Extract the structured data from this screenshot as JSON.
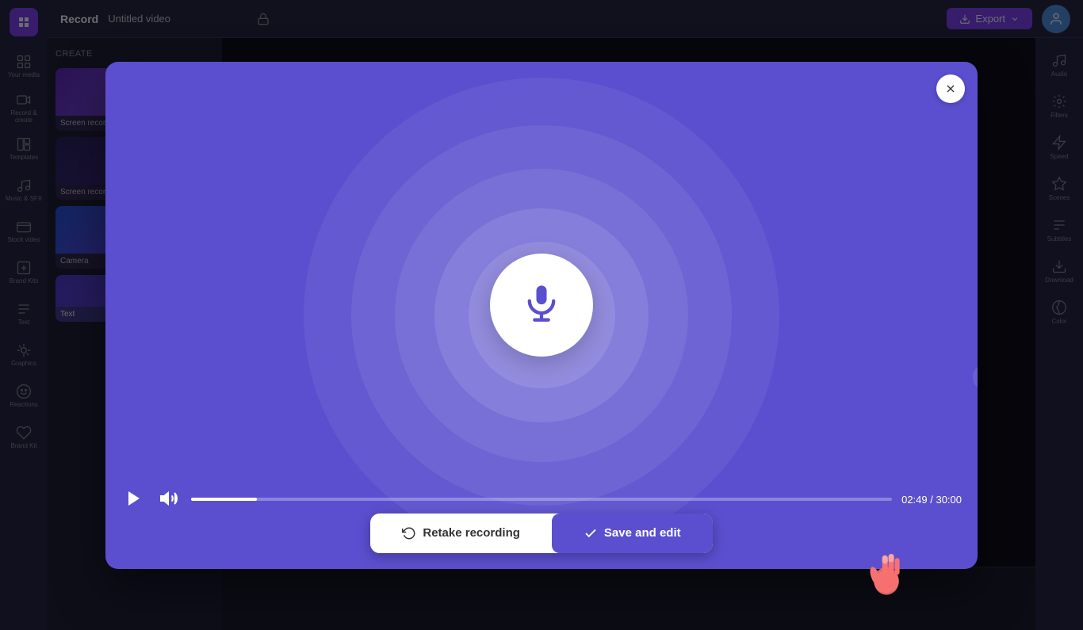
{
  "app": {
    "title": "Record"
  },
  "header": {
    "record_title": "Record",
    "video_title": "Untitled video",
    "export_label": "Export"
  },
  "modal": {
    "close_label": "×",
    "time_current": "02:49",
    "time_total": "30:00",
    "time_display": "02:49 / 30:00"
  },
  "actions": {
    "retake_label": "Retake recording",
    "save_label": "Save and edit"
  },
  "sidebar": {
    "items": [
      {
        "label": "Your media",
        "icon": "grid"
      },
      {
        "label": "Record & create",
        "icon": "video"
      },
      {
        "label": "Templates",
        "icon": "layout"
      },
      {
        "label": "Music & SFX",
        "icon": "music"
      },
      {
        "label": "Stock video",
        "icon": "film"
      },
      {
        "label": "Brand Kits",
        "icon": "bookmark"
      },
      {
        "label": "Text",
        "icon": "type"
      },
      {
        "label": "Graphics",
        "icon": "shapes"
      },
      {
        "label": "Reactions",
        "icon": "smile"
      },
      {
        "label": "Brand Kit",
        "icon": "flag"
      }
    ]
  },
  "right_sidebar": {
    "items": [
      {
        "label": "Audio",
        "icon": "music"
      },
      {
        "label": "Filters",
        "icon": "sliders"
      },
      {
        "label": "Speed",
        "icon": "zap"
      },
      {
        "label": "Scenes",
        "icon": "layers"
      },
      {
        "label": "Subtitles",
        "icon": "align-left"
      },
      {
        "label": "Download",
        "icon": "download"
      },
      {
        "label": "Color",
        "icon": "droplet"
      }
    ]
  },
  "thumbnails": [
    {
      "label": "Screen recording",
      "type": "purple"
    },
    {
      "label": "Screen recording",
      "type": "dark"
    },
    {
      "label": "Camera",
      "type": "blue"
    },
    {
      "label": "Text",
      "type": "purple"
    }
  ],
  "colors": {
    "modal_bg": "#5b4fcf",
    "save_btn": "#5b4fcf",
    "mic_circle": "#ffffff",
    "circle1": "rgba(255,255,255,0.05)",
    "circle2": "rgba(255,255,255,0.07)",
    "circle3": "rgba(255,255,255,0.09)"
  }
}
